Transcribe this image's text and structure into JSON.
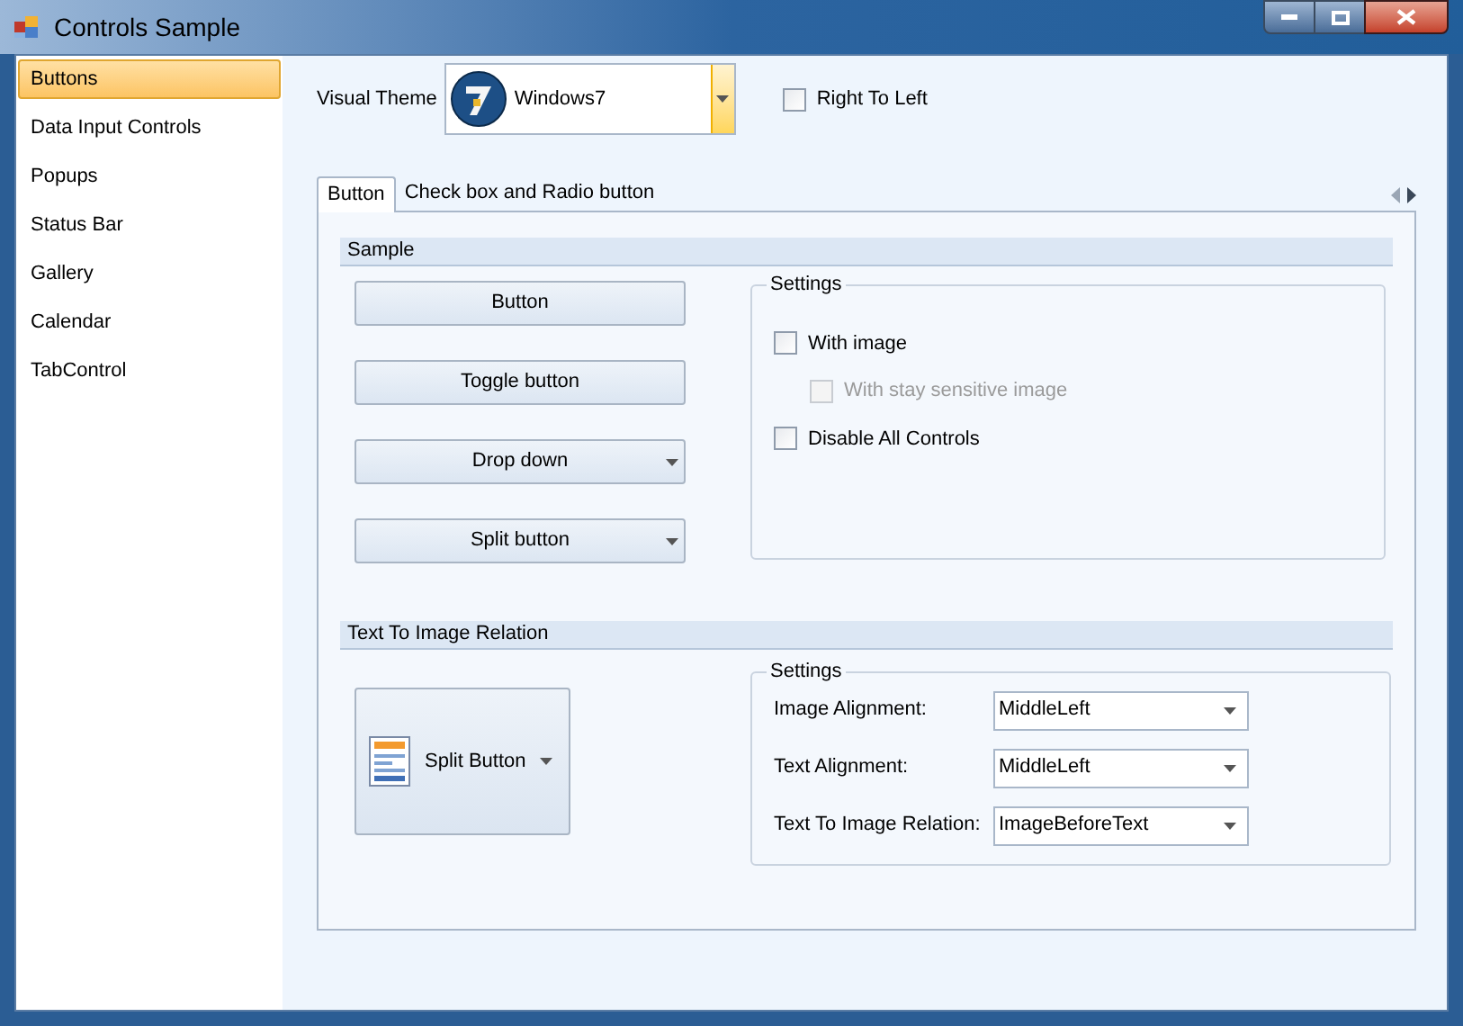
{
  "window": {
    "title": "Controls Sample"
  },
  "sidebar": {
    "items": [
      {
        "label": "Buttons",
        "selected": true
      },
      {
        "label": "Data Input Controls",
        "selected": false
      },
      {
        "label": "Popups",
        "selected": false
      },
      {
        "label": "Status Bar",
        "selected": false
      },
      {
        "label": "Gallery",
        "selected": false
      },
      {
        "label": "Calendar",
        "selected": false
      },
      {
        "label": "TabControl",
        "selected": false
      }
    ]
  },
  "visual_theme": {
    "label": "Visual Theme",
    "value": "Windows7"
  },
  "right_to_left": {
    "label": "Right To Left",
    "checked": false
  },
  "tabs": [
    {
      "label": "Button",
      "selected": true
    },
    {
      "label": "Check box and Radio button",
      "selected": false
    }
  ],
  "sample": {
    "title": "Sample",
    "buttons": [
      {
        "label": "Button",
        "kind": "plain"
      },
      {
        "label": "Toggle button",
        "kind": "plain"
      },
      {
        "label": "Drop down",
        "kind": "dropdown"
      },
      {
        "label": "Split button",
        "kind": "dropdown"
      }
    ],
    "settings": {
      "title": "Settings",
      "checkboxes": [
        {
          "label": "With image",
          "checked": false,
          "disabled": false,
          "children": [
            {
              "label": "With stay sensitive image",
              "checked": false,
              "disabled": true
            }
          ]
        },
        {
          "label": "Disable All Controls",
          "checked": false,
          "disabled": false
        }
      ]
    }
  },
  "relation": {
    "title": "Text To Image Relation",
    "preview_button": {
      "label": "Split Button"
    },
    "settings": {
      "title": "Settings",
      "fields": [
        {
          "label": "Image Alignment:",
          "value": "MiddleLeft"
        },
        {
          "label": "Text Alignment:",
          "value": "MiddleLeft"
        },
        {
          "label": "Text To Image Relation:",
          "value": "ImageBeforeText"
        }
      ]
    }
  }
}
